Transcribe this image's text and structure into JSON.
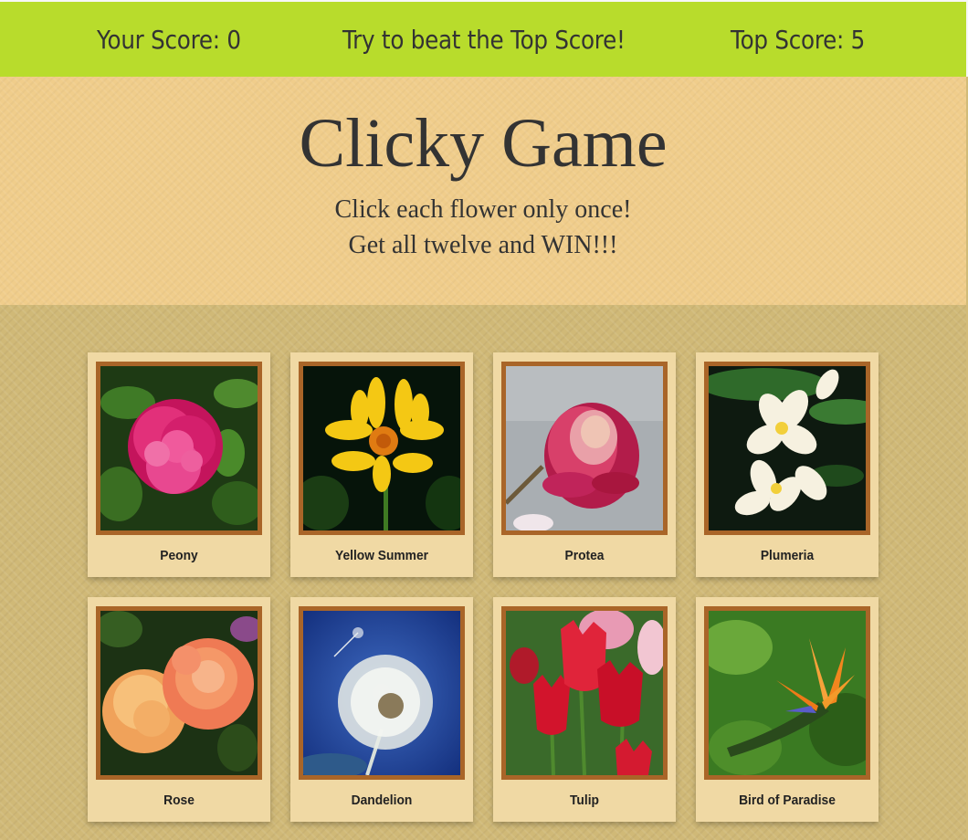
{
  "navbar": {
    "score_text": "Your Score: 0",
    "message": "Try to beat the Top Score!",
    "top_score_text": "Top Score: 5"
  },
  "header": {
    "title": "Clicky Game",
    "line1": "Click each flower only once!",
    "line2": "Get all twelve and WIN!!!"
  },
  "cards": [
    {
      "label": "Peony",
      "image": "peony-image"
    },
    {
      "label": "Yellow Summer",
      "image": "yellow-summer-image"
    },
    {
      "label": "Protea",
      "image": "protea-image"
    },
    {
      "label": "Plumeria",
      "image": "plumeria-image"
    },
    {
      "label": "Rose",
      "image": "rose-image"
    },
    {
      "label": "Dandelion",
      "image": "dandelion-image"
    },
    {
      "label": "Tulip",
      "image": "tulip-image"
    },
    {
      "label": "Bird of Paradise",
      "image": "bird-of-paradise-image"
    }
  ],
  "colors": {
    "navbar": "#b8dc2c",
    "header": "#f0cd8b",
    "board": "#d0b977",
    "card": "#f0d9a4",
    "frame": "#a96528"
  }
}
